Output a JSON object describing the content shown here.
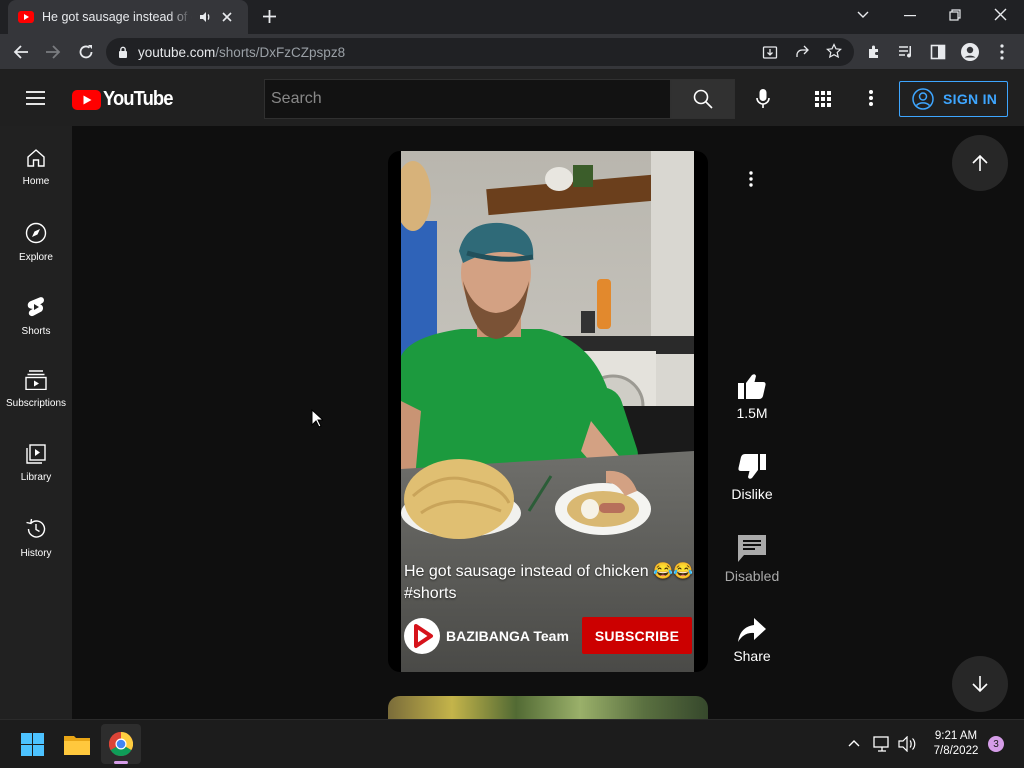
{
  "browser": {
    "tab_title": "He got sausage instead of chicken 😂😂 #shorts - YouTube",
    "url_host": "youtube.com",
    "url_path": "/shorts/DxFzCZpspz8"
  },
  "header": {
    "logo_text": "YouTube",
    "search_placeholder": "Search",
    "signin_label": "SIGN IN"
  },
  "sidebar": {
    "items": [
      {
        "label": "Home",
        "icon": "home-icon"
      },
      {
        "label": "Explore",
        "icon": "compass-icon"
      },
      {
        "label": "Shorts",
        "icon": "shorts-icon"
      },
      {
        "label": "Subscriptions",
        "icon": "subscriptions-icon"
      },
      {
        "label": "Library",
        "icon": "library-icon"
      },
      {
        "label": "History",
        "icon": "history-icon"
      }
    ]
  },
  "short": {
    "caption": "He got sausage instead of chicken 😂😂 #shorts",
    "channel_name": "BAZIBANGA Team",
    "subscribe_label": "SUBSCRIBE"
  },
  "actions": {
    "like_count": "1.5M",
    "dislike_label": "Dislike",
    "comments_label": "Disabled",
    "share_label": "Share"
  },
  "taskbar": {
    "time": "9:21 AM",
    "date": "7/8/2022",
    "notification_count": "3"
  },
  "colors": {
    "youtube_red": "#ff0000",
    "subscribe_red": "#cc0000",
    "signin_blue": "#3ea6ff",
    "background": "#0f0f0f"
  }
}
